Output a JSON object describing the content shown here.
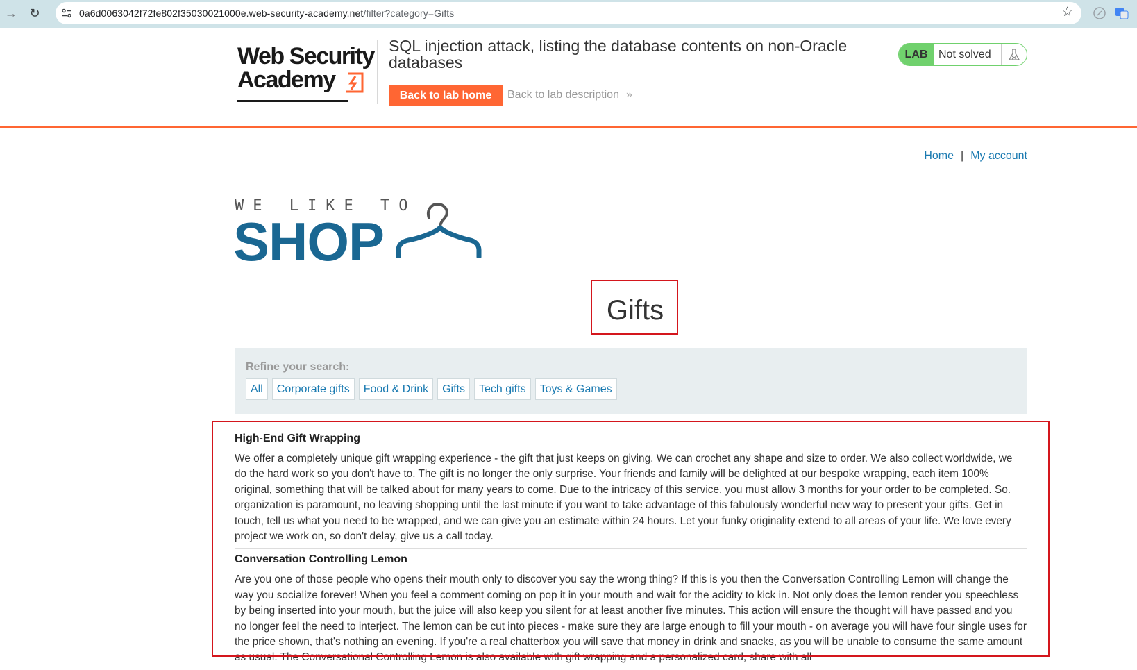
{
  "browser": {
    "url_host": "0a6d0063042f72fe802f35030021000e.web-security-academy.net",
    "url_path": "/filter?category=Gifts"
  },
  "lab": {
    "logo_line1": "Web Security",
    "logo_line2": "Academy",
    "title": "SQL injection attack, listing the database contents on non-Oracle databases",
    "back_home_label": "Back to lab home",
    "back_description_label": "Back to lab description",
    "badge_label": "LAB",
    "status": "Not solved"
  },
  "nav": {
    "home": "Home",
    "separator": "|",
    "account": "My account"
  },
  "shop_logo": {
    "tagline": "WE LIKE TO",
    "word": "SHOP"
  },
  "page_heading": "Gifts",
  "filter": {
    "label": "Refine your search:",
    "categories": [
      "All",
      "Corporate gifts",
      "Food & Drink",
      "Gifts",
      "Tech gifts",
      "Toys & Games"
    ]
  },
  "products": [
    {
      "name": "High-End Gift Wrapping",
      "description": "We offer a completely unique gift wrapping experience - the gift that just keeps on giving. We can crochet any shape and size to order. We also collect worldwide, we do the hard work so you don't have to. The gift is no longer the only surprise. Your friends and family will be delighted at our bespoke wrapping, each item 100% original, something that will be talked about for many years to come. Due to the intricacy of this service, you must allow 3 months for your order to be completed. So. organization is paramount, no leaving shopping until the last minute if you want to take advantage of this fabulously wonderful new way to present your gifts. Get in touch, tell us what you need to be wrapped, and we can give you an estimate within 24 hours. Let your funky originality extend to all areas of your life. We love every project we work on, so don't delay, give us a call today."
    },
    {
      "name": "Conversation Controlling Lemon",
      "description": "Are you one of those people who opens their mouth only to discover you say the wrong thing? If this is you then the Conversation Controlling Lemon will change the way you socialize forever! When you feel a comment coming on pop it in your mouth and wait for the acidity to kick in. Not only does the lemon render you speechless by being inserted into your mouth, but the juice will also keep you silent for at least another five minutes. This action will ensure the thought will have passed and you no longer feel the need to interject. The lemon can be cut into pieces - make sure they are large enough to fill your mouth - on average you will have four single uses for the price shown, that's nothing an evening. If you're a real chatterbox you will save that money in drink and snacks, as you will be unable to consume the same amount as usual. The Conversational Controlling Lemon is also available with gift wrapping and a personalized card, share with all"
    }
  ],
  "colors": {
    "accent_orange": "#ff6633",
    "shop_blue": "#1a6792",
    "link_blue": "#1a7ab1",
    "lab_green": "#70d16d",
    "annotation_red": "#d4161d"
  }
}
